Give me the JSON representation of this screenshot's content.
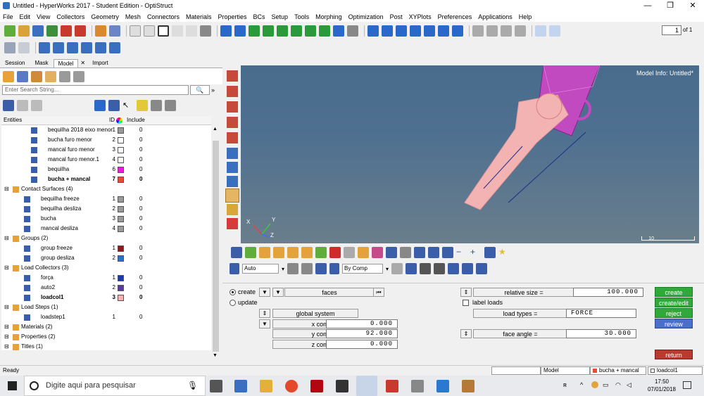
{
  "window": {
    "title": "Untitled - HyperWorks 2017 - Student Edition - OptiStruct"
  },
  "menu": [
    "File",
    "Edit",
    "View",
    "Collectors",
    "Geometry",
    "Mesh",
    "Connectors",
    "Materials",
    "Properties",
    "BCs",
    "Setup",
    "Tools",
    "Morphing",
    "Optimization",
    "Post",
    "XYPlots",
    "Preferences",
    "Applications",
    "Help"
  ],
  "page_input": {
    "value": "1",
    "of": "of 1"
  },
  "tabs": [
    "Session",
    "Mask",
    "Model",
    "Import"
  ],
  "search": {
    "placeholder": "Enter Search String..."
  },
  "entity_header": {
    "entities": "Entities",
    "id": "ID",
    "include": "Include"
  },
  "tree": [
    {
      "label": "bequilha 2018 eixo menor",
      "id": "1",
      "color": "#9a9a9a",
      "include": "0",
      "indent": 2
    },
    {
      "label": "bucha furo menor",
      "id": "2",
      "color": "#ffffff",
      "include": "0",
      "indent": 2
    },
    {
      "label": "mancal furo menor",
      "id": "3",
      "color": "#ffffff",
      "include": "0",
      "indent": 2
    },
    {
      "label": "mancal furo menor.1",
      "id": "4",
      "color": "#ffffff",
      "include": "0",
      "indent": 2
    },
    {
      "label": "bequilha",
      "id": "6",
      "color": "#e31fe0",
      "include": "0",
      "indent": 2
    },
    {
      "label": "bucha + mancal",
      "id": "7",
      "color": "#e84a36",
      "include": "0",
      "indent": 2,
      "bold": true
    },
    {
      "label": "Contact Surfaces (4)",
      "indent": 0,
      "group": true
    },
    {
      "label": "bequilha freeze",
      "id": "1",
      "color": "#9a9a9a",
      "include": "0",
      "indent": 1
    },
    {
      "label": "bequilha desliza",
      "id": "2",
      "color": "#9a9a9a",
      "include": "0",
      "indent": 1
    },
    {
      "label": "bucha",
      "id": "3",
      "color": "#9a9a9a",
      "include": "0",
      "indent": 1
    },
    {
      "label": "mancal desliza",
      "id": "4",
      "color": "#9a9a9a",
      "include": "0",
      "indent": 1
    },
    {
      "label": "Groups (2)",
      "indent": 0,
      "group": true
    },
    {
      "label": "group freeze",
      "id": "1",
      "color": "#8b1a1a",
      "include": "0",
      "indent": 1
    },
    {
      "label": "group desliza",
      "id": "2",
      "color": "#2a6fd6",
      "include": "0",
      "indent": 1
    },
    {
      "label": "Load Collectors (3)",
      "indent": 0,
      "group": true
    },
    {
      "label": "força",
      "id": "1",
      "color": "#1f3aa8",
      "include": "0",
      "indent": 1
    },
    {
      "label": "auto2",
      "id": "2",
      "color": "#5a3a9a",
      "include": "0",
      "indent": 1
    },
    {
      "label": "loadcol1",
      "id": "3",
      "color": "#f4b3b3",
      "include": "0",
      "indent": 1,
      "bold": true
    },
    {
      "label": "Load Steps (1)",
      "indent": 0,
      "group": true
    },
    {
      "label": "loadstep1",
      "id": "1",
      "include": "0",
      "indent": 1
    },
    {
      "label": "Materials (2)",
      "indent": 0,
      "group": true
    },
    {
      "label": "Properties (2)",
      "indent": 0,
      "group": true
    },
    {
      "label": "Titles (1)",
      "indent": 0,
      "group": true
    }
  ],
  "viewport": {
    "model_info": "Model Info: Untitled*",
    "scale": "10"
  },
  "view_options": {
    "auto": "Auto",
    "by_comp": "By Comp"
  },
  "panel": {
    "create": "create",
    "update": "update",
    "faces": "faces",
    "global_system": "global system",
    "x_label": "x comp =",
    "x_val": "0.000",
    "y_label": "y comp =",
    "y_val": "92.000",
    "z_label": "z comp =",
    "z_val": "0.000",
    "relative_size_label": "relative size =",
    "relative_size_val": "100.000",
    "label_loads": "label loads",
    "load_types_label": "load types =",
    "load_types_val": "FORCE",
    "face_angle_label": "face angle =",
    "face_angle_val": "30.000",
    "btn_create": "create",
    "btn_create_edit": "create/edit",
    "btn_reject": "reject",
    "btn_review": "review",
    "btn_return": "return"
  },
  "status": {
    "ready": "Ready",
    "model": "Model",
    "component": "bucha + mancal",
    "loadcol": "loadcol1"
  },
  "taskbar": {
    "search_placeholder": "Digite aqui para pesquisar",
    "time": "17:50",
    "date": "07/01/2018"
  },
  "colors": {
    "viewport_top": "#496c8c",
    "mesh": "#d24ad0",
    "part": "#f4b3b3",
    "create_green": "#2faa3a",
    "review_blue": "#4a6fc8",
    "return_red": "#b93a2f"
  }
}
